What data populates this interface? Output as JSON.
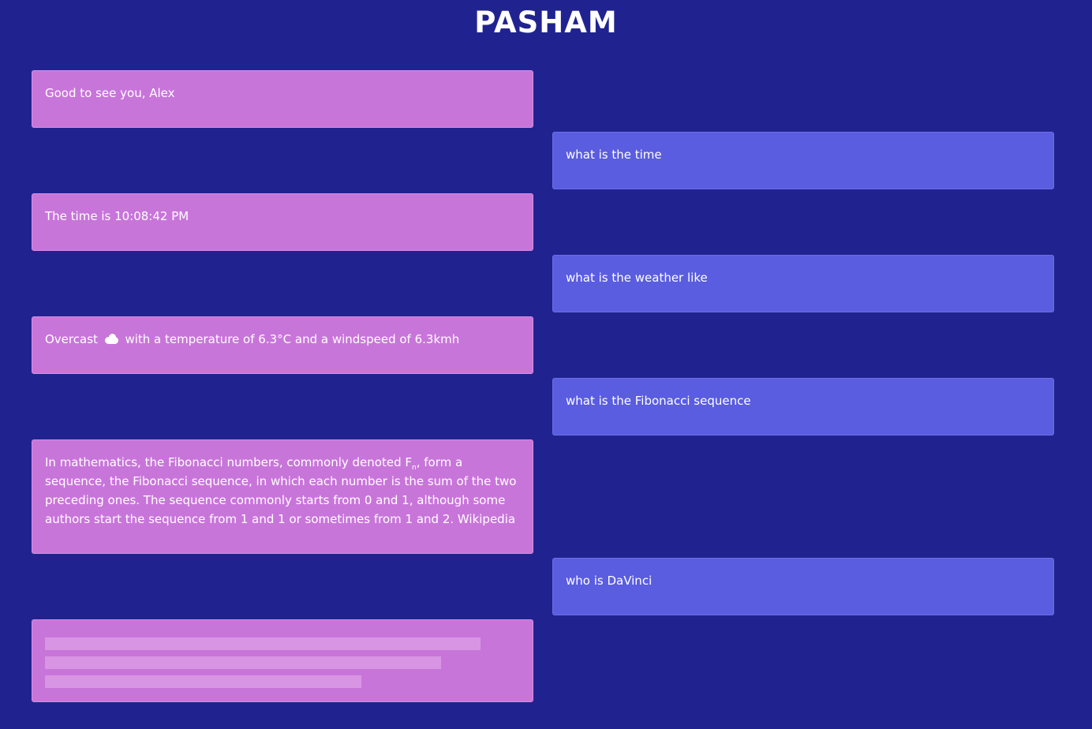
{
  "header": {
    "title": "PASHAM"
  },
  "conversation": {
    "greeting": "Good to see you, Alex",
    "q_time": "what is the time",
    "a_time": "The time is 10:08:42 PM",
    "q_weather": "what is the weather like",
    "a_weather_prefix": "Overcast",
    "a_weather_icon": "cloud-icon",
    "a_weather_suffix": "with a temperature of 6.3°C and a windspeed of 6.3kmh",
    "q_fibonacci": "what is the Fibonacci sequence",
    "a_fibonacci_part1": "In mathematics, the Fibonacci numbers, commonly denoted F",
    "a_fibonacci_sub": "n",
    "a_fibonacci_part2": ", form a sequence, the Fibonacci sequence, in which each number is the sum of the two preceding ones. The sequence commonly starts from 0 and 1, although some authors start the sequence from 1 and 1 or sometimes from 1 and 2. Wikipedia",
    "q_davinci": "who is DaVinci"
  },
  "colors": {
    "background": "#20238f",
    "bot_bubble": "#c875da",
    "user_bubble": "#5a5ddf",
    "skeleton": "#d895e3"
  }
}
